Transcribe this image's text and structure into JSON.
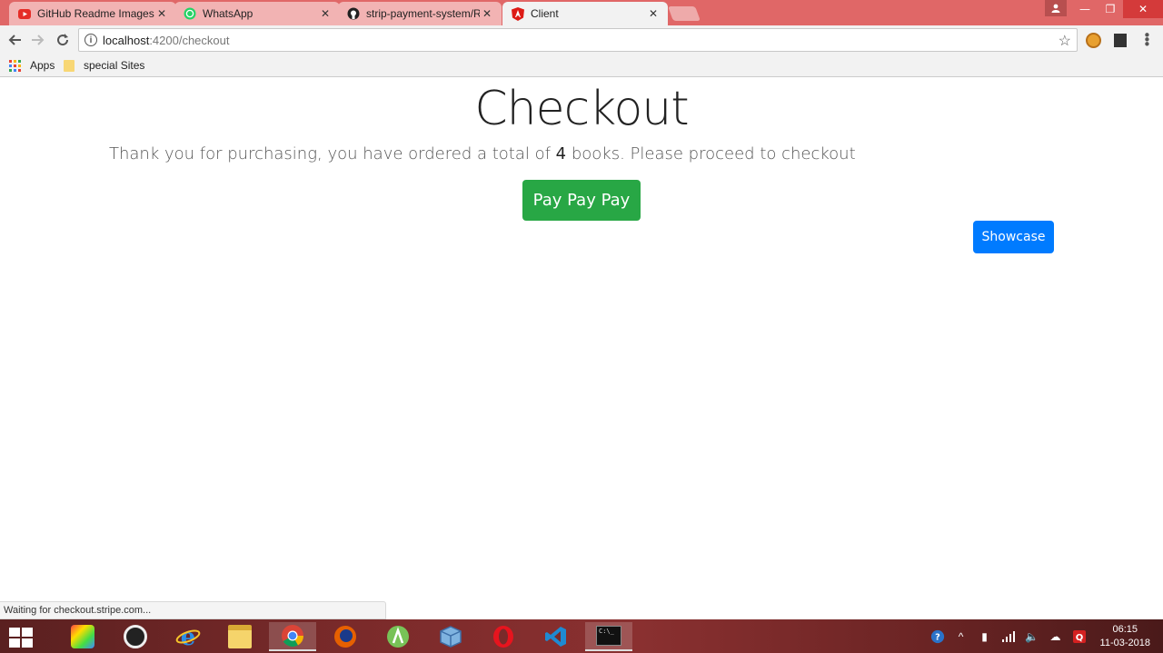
{
  "browser": {
    "tabs": [
      {
        "title": "GitHub Readme Images",
        "favicon": "youtube-icon",
        "active": false
      },
      {
        "title": "WhatsApp",
        "favicon": "whatsapp-icon",
        "active": false
      },
      {
        "title": "strip-payment-system/R",
        "favicon": "github-icon",
        "active": false
      },
      {
        "title": "Client",
        "favicon": "angular-icon",
        "active": true
      }
    ],
    "url_host": "localhost",
    "url_path": ":4200/checkout",
    "bookmarks": [
      {
        "label": "Apps",
        "icon": "apps-grid-icon"
      },
      {
        "label": "special Sites",
        "icon": "folder-icon"
      }
    ]
  },
  "page": {
    "heading": "Checkout",
    "lead_before": "Thank you for purchasing, you have ordered a total of ",
    "lead_count": "4",
    "lead_after": " books. Please proceed to checkout",
    "pay_button": "Pay Pay Pay",
    "showcase_button": "Showcase"
  },
  "status_text": "Waiting for checkout.stripe.com...",
  "taskbar": {
    "apps": [
      "start-icon",
      "app-grid-icon",
      "camera-icon",
      "internet-explorer-icon",
      "file-explorer-icon",
      "chrome-icon",
      "firefox-icon",
      "android-studio-icon",
      "virtualbox-icon",
      "opera-icon",
      "vscode-icon",
      "cmd-icon"
    ],
    "time": "06:15",
    "date": "11-03-2018"
  },
  "colors": {
    "tabstrip": "#e06767",
    "pay_button": "#28a745",
    "showcase_button": "#007bff"
  }
}
